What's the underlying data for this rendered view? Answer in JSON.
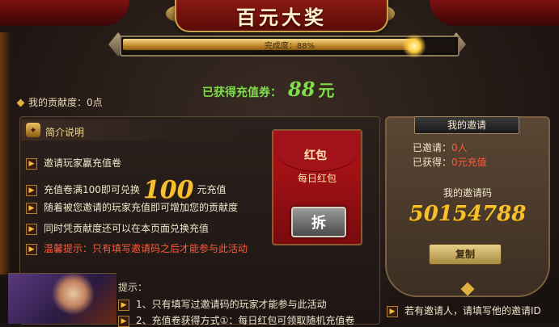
{
  "header": {
    "title": "百元大奖"
  },
  "progress": {
    "label": "完成度：88%",
    "percent": 88
  },
  "coupon": {
    "label": "已获得充值券：",
    "amount": "88",
    "unit": "元"
  },
  "contribution": {
    "label": "我的贡献度：",
    "value": "0点"
  },
  "intro": {
    "title": "简介说明",
    "rules": [
      {
        "text": "邀请玩家赢充值卷"
      },
      {
        "pre": "充值卷满100即可兑换",
        "big": "100",
        "post": "元充值"
      },
      {
        "text": "随着被您邀请的玩家充值即可增加您的贡献度"
      },
      {
        "text": "同时凭贡献度还可以在本页面兑换充值"
      },
      {
        "text": "温馨提示：只有填写邀请码之后才能参与此活动"
      }
    ]
  },
  "envelope": {
    "title": "红包",
    "subtitle": "每日红包",
    "button": "拆"
  },
  "hints": {
    "title": "提示：",
    "items": [
      "1、只有填写过邀请码的玩家才能参与此活动",
      "2、充值卷获得方式①：每日红包可领取随机充值卷"
    ]
  },
  "invite": {
    "title": "我的邀请",
    "invited_label": "已邀请：",
    "invited_value": "0人",
    "earned_label": "已获得：",
    "earned_value": "0元充值",
    "code_label": "我的邀请码",
    "code": "50154788",
    "copy_button": "复制",
    "notes": [
      "若有邀请人，请填写他的邀请ID"
    ]
  }
}
